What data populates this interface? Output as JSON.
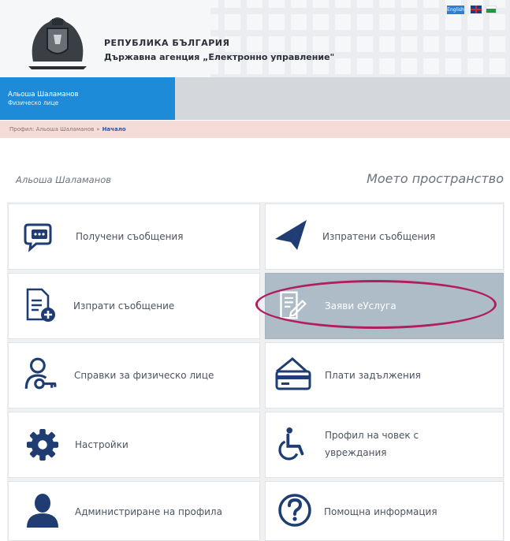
{
  "header": {
    "country": "РЕПУБЛИКА БЪЛГАРИЯ",
    "agency": "Държавна агенция „Електронно управление\"",
    "lang_badge": "English"
  },
  "user": {
    "name": "Альоша Шаламанов",
    "type": "Физическо лице"
  },
  "breadcrumb": {
    "item1": "Профил: Альоша Шаламанов",
    "separator": "»",
    "current": "Начало"
  },
  "profile": {
    "name": "Альоша Шаламанов",
    "section_title": "Моето пространство"
  },
  "tiles": [
    {
      "label": "Получени съобщения",
      "icon": "message-icon"
    },
    {
      "label": "Изпратени съобщения",
      "icon": "paper-plane-icon"
    },
    {
      "label": "Изпрати съобщение",
      "icon": "document-add-icon"
    },
    {
      "label": "Заяви еУслуга",
      "icon": "form-edit-icon",
      "active": true
    },
    {
      "label": "Справки за физическо лице",
      "icon": "person-key-icon"
    },
    {
      "label": "Плати задължения",
      "icon": "card-payment-icon"
    },
    {
      "label": "Настройки",
      "icon": "gear-icon"
    },
    {
      "label_line1": "Профил на човек с",
      "label_line2": "увреждания",
      "icon": "wheelchair-icon"
    },
    {
      "label": "Администриране на профила",
      "icon": "user-icon"
    },
    {
      "label": "Помощна информация",
      "icon": "help-icon"
    }
  ],
  "colors": {
    "accent_blue": "#1e8bd8",
    "icon_navy": "#1f3d72",
    "active_tile": "#aebcc7",
    "highlight": "#b01e5f"
  }
}
